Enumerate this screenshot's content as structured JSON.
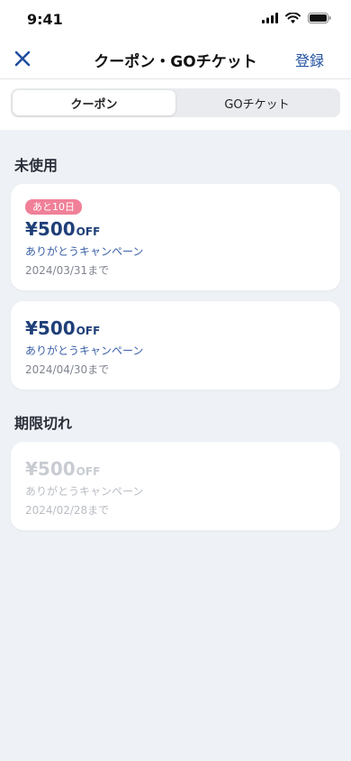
{
  "status_bar": {
    "time": "9:41"
  },
  "nav": {
    "title": "クーポン・GOチケット",
    "register_label": "登録"
  },
  "tabs": [
    {
      "label": "クーポン",
      "active": true
    },
    {
      "label": "GOチケット",
      "active": false
    }
  ],
  "sections": {
    "unused": {
      "title": "未使用",
      "coupons": [
        {
          "badge": "あと10日",
          "amount": "¥500",
          "suffix": "OFF",
          "campaign": "ありがとうキャンペーン",
          "expiry": "2024/03/31まで"
        },
        {
          "amount": "¥500",
          "suffix": "OFF",
          "campaign": "ありがとうキャンペーン",
          "expiry": "2024/04/30まで"
        }
      ]
    },
    "expired": {
      "title": "期限切れ",
      "coupons": [
        {
          "amount": "¥500",
          "suffix": "OFF",
          "campaign": "ありがとうキャンペーン",
          "expiry": "2024/02/28まで"
        }
      ]
    }
  },
  "colors": {
    "accent": "#1f4fa0",
    "amount": "#1f3f78",
    "badge": "#f08098",
    "background": "#eef1f5"
  }
}
